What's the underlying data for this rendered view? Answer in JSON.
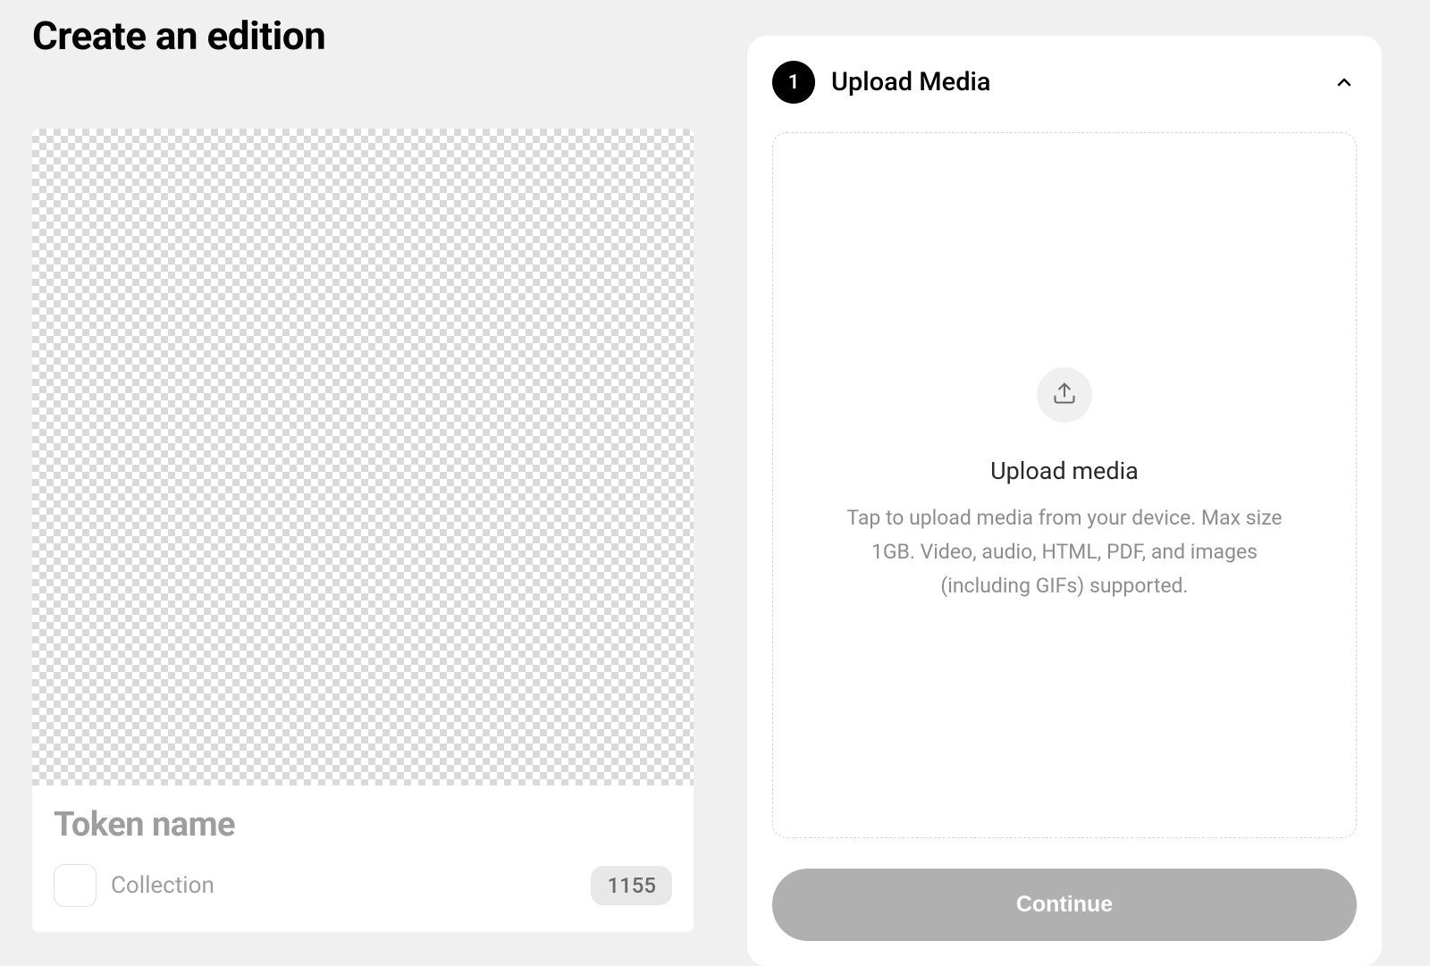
{
  "pageTitle": "Create an edition",
  "preview": {
    "tokenNamePlaceholder": "Token name",
    "collectionLabel": "Collection",
    "badge": "1155"
  },
  "panel": {
    "stepNumber": "1",
    "title": "Upload Media",
    "upload": {
      "title": "Upload media",
      "description": "Tap to upload media from your device. Max size 1GB. Video, audio, HTML, PDF, and images (including GIFs) supported."
    },
    "continueLabel": "Continue"
  }
}
